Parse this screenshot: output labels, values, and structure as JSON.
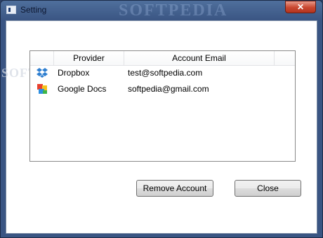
{
  "window": {
    "title": "Setting",
    "watermark": "SOFTPEDIA"
  },
  "grid": {
    "columns": [
      "Provider",
      "Account Email"
    ],
    "rows": [
      {
        "icon": "dropbox-icon",
        "provider": "Dropbox",
        "email": "test@softpedia.com"
      },
      {
        "icon": "google-docs-icon",
        "provider": "Google Docs",
        "email": "softpedia@gmail.com"
      }
    ]
  },
  "buttons": {
    "remove_label": "Remove Account",
    "close_label": "Close"
  },
  "colors": {
    "title_bar": "#3a5583",
    "close_button": "#c9472f"
  }
}
